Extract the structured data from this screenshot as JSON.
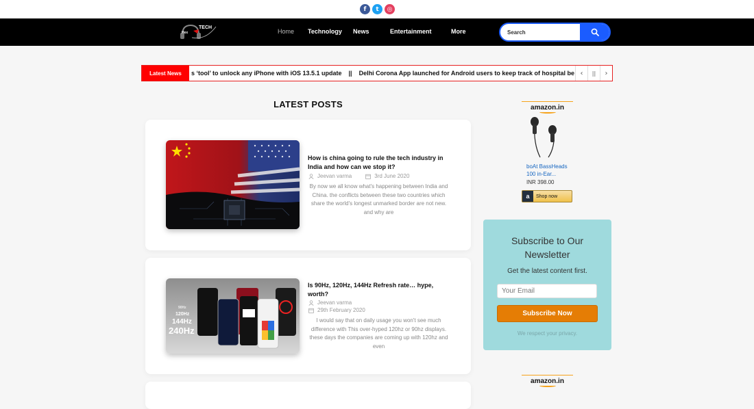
{
  "social": {
    "facebook_glyph": "f",
    "twitter_glyph": "t",
    "instagram_glyph": "◎"
  },
  "logo": {
    "text": "TECH",
    "prefix": "Hex"
  },
  "nav": {
    "items": [
      "Home",
      "Technology",
      "News",
      "Entertainment",
      "More"
    ],
    "active": "Home"
  },
  "search": {
    "placeholder": "Search",
    "icon": "search-icon"
  },
  "ticker": {
    "label": "Latest News",
    "text": "s ‘tool’ to unlock any iPhone with iOS 13.5.1 update    ||    Delhi Corona App launched for Android users to keep track of hospital be",
    "prev": "‹",
    "pause": "||",
    "next": "›"
  },
  "main": {
    "section_title": "LATEST POSTS",
    "posts": [
      {
        "title": "How is china going to rule the tech industry in India and how can we stop it?",
        "author": "Jeevan varma",
        "date": "3rd June 2020",
        "excerpt": "By now we all know what's happening between India and China. the conflicts between these two countries which share the world's longest unmarked border are not new. and why are"
      },
      {
        "title": "Is 90Hz, 120Hz, 144Hz Refresh rate… hype, worth?",
        "author": "Jeevan varma",
        "date": "29th February 2020",
        "excerpt": "I would say that on daily usage you won't see much difference with This over-hyped 120hz or 90hz displays. these days the companies are coming up with 120hz and even",
        "thumb_labels": [
          "90Hz",
          "120Hz",
          "144Hz",
          "240Hz"
        ]
      }
    ]
  },
  "sidebar": {
    "amazon_logo": "amazon.in",
    "product": {
      "name": "boAt BassHeads 100 in-Ear...",
      "price": "INR 398.00",
      "button": "Shop now",
      "button_icon": "a"
    },
    "newsletter": {
      "title": "Subscribe to Our Newsletter",
      "subtitle": "Get the latest content first.",
      "email_placeholder": "Your Email",
      "button": "Subscribe Now",
      "privacy": "We respect your privacy."
    },
    "amazon_logo_2": "amazon.in"
  },
  "colors": {
    "nav_bg": "#000000",
    "accent_blue": "#1b5cff",
    "ticker_red": "#ff0000",
    "newsletter_bg": "#9fdadd",
    "subscribe_orange": "#e57d05"
  }
}
